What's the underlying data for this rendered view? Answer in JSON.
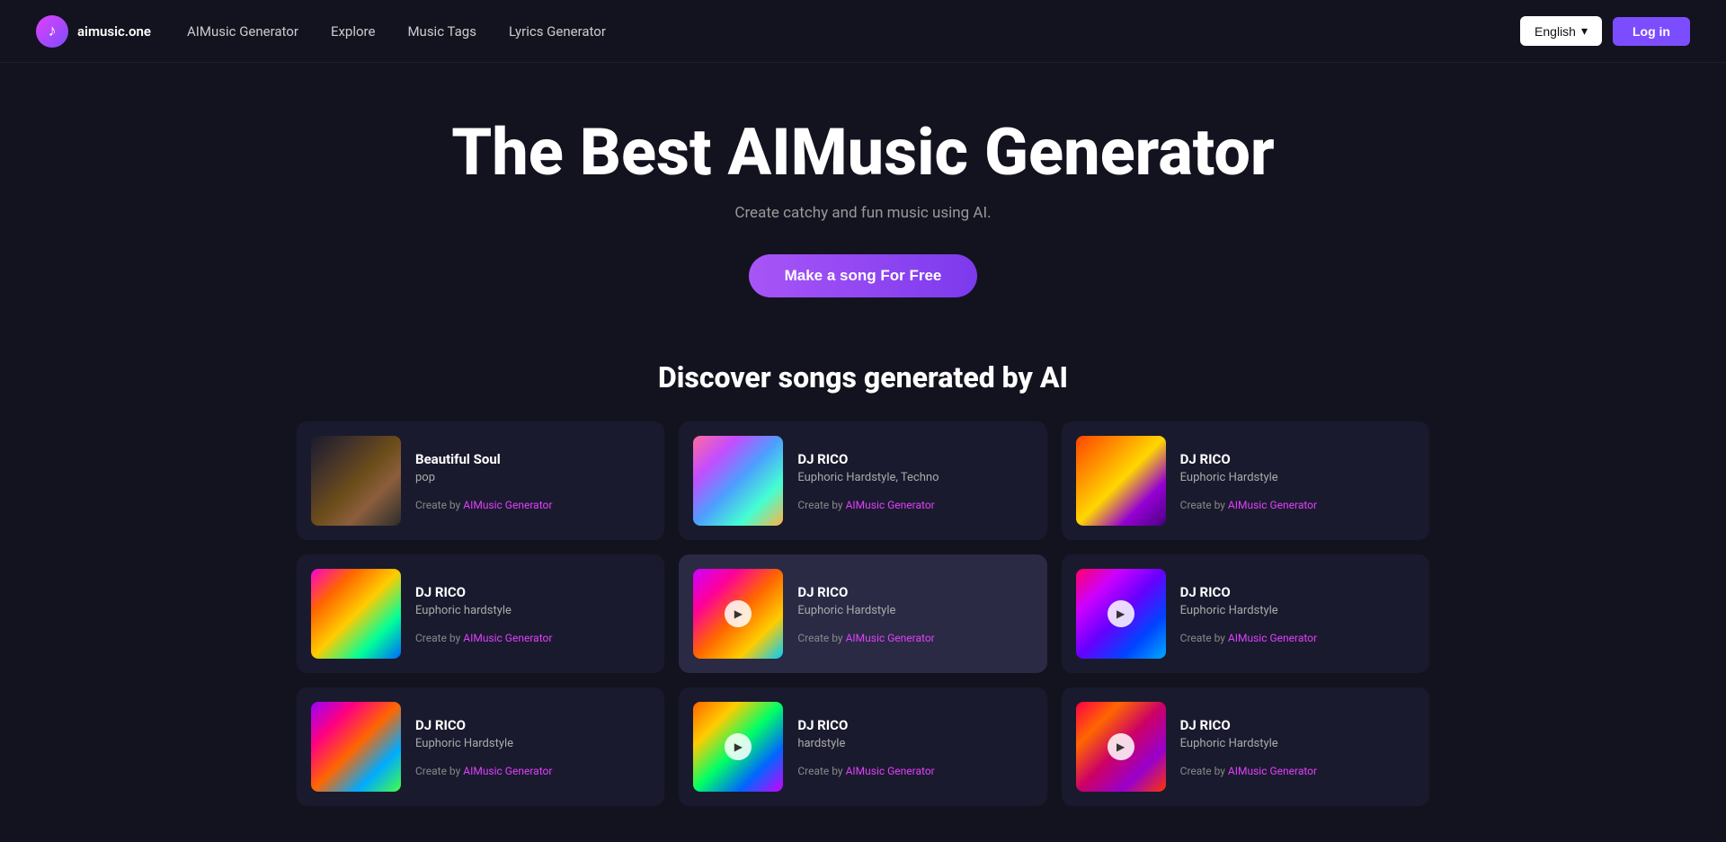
{
  "navbar": {
    "logo_text": "aimusic.one",
    "logo_icon": "♪",
    "links": [
      {
        "label": "AIMusic Generator",
        "name": "nav-aimusic-generator"
      },
      {
        "label": "Explore",
        "name": "nav-explore"
      },
      {
        "label": "Music Tags",
        "name": "nav-music-tags"
      },
      {
        "label": "Lyrics Generator",
        "name": "nav-lyrics-generator"
      }
    ],
    "lang_label": "English",
    "lang_icon": "▾",
    "login_label": "Log in"
  },
  "hero": {
    "title": "The Best AIMusic Generator",
    "subtitle": "Create catchy and fun music using AI.",
    "cta_label": "Make a song For Free"
  },
  "discover": {
    "title": "Discover songs generated by AI",
    "songs": [
      {
        "id": 1,
        "name": "Beautiful Soul",
        "genre": "pop",
        "creator_prefix": "Create by ",
        "creator_link": "AIMusic Generator",
        "thumb_class": "thumb-1",
        "has_play": false,
        "active": false
      },
      {
        "id": 2,
        "name": "DJ RICO",
        "genre": "Euphoric Hardstyle, Techno",
        "creator_prefix": "Create by ",
        "creator_link": "AIMusic Generator",
        "thumb_class": "thumb-2",
        "has_play": false,
        "active": false
      },
      {
        "id": 3,
        "name": "DJ RICO",
        "genre": "Euphoric Hardstyle",
        "creator_prefix": "Create by ",
        "creator_link": "AIMusic Generator",
        "thumb_class": "thumb-3",
        "has_play": false,
        "active": false
      },
      {
        "id": 4,
        "name": "DJ RICO",
        "genre": "Euphoric hardstyle",
        "creator_prefix": "Create by ",
        "creator_link": "AIMusic Generator",
        "thumb_class": "thumb-4",
        "has_play": false,
        "active": false
      },
      {
        "id": 5,
        "name": "DJ RICO",
        "genre": "Euphoric Hardstyle",
        "creator_prefix": "Create by ",
        "creator_link": "AIMusic Generator",
        "thumb_class": "thumb-5",
        "has_play": true,
        "active": true
      },
      {
        "id": 6,
        "name": "DJ RICO",
        "genre": "Euphoric Hardstyle",
        "creator_prefix": "Create by ",
        "creator_link": "AIMusic Generator",
        "thumb_class": "thumb-6",
        "has_play": true,
        "active": false
      },
      {
        "id": 7,
        "name": "DJ RICO",
        "genre": "Euphoric Hardstyle",
        "creator_prefix": "Create by ",
        "creator_link": "AIMusic Generator",
        "thumb_class": "thumb-7",
        "has_play": false,
        "active": false
      },
      {
        "id": 8,
        "name": "DJ RICO",
        "genre": "hardstyle",
        "creator_prefix": "Create by ",
        "creator_link": "AIMusic Generator",
        "thumb_class": "thumb-8",
        "has_play": true,
        "active": false
      },
      {
        "id": 9,
        "name": "DJ RICO",
        "genre": "Euphoric Hardstyle",
        "creator_prefix": "Create by ",
        "creator_link": "AIMusic Generator",
        "thumb_class": "thumb-9",
        "has_play": true,
        "active": false
      }
    ]
  }
}
